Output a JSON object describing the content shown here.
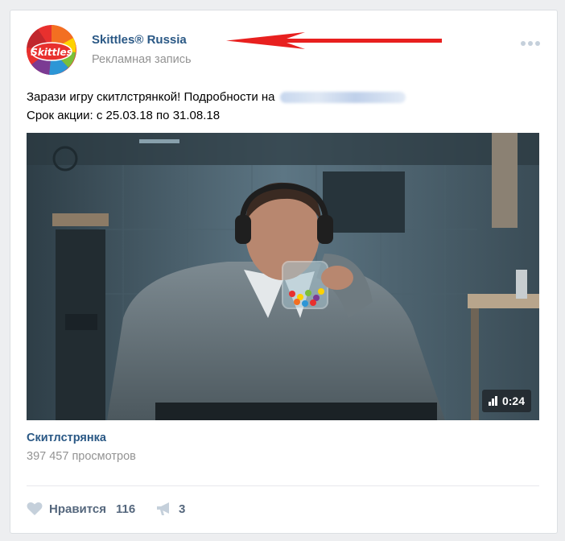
{
  "post": {
    "author": "Skittles® Russia",
    "post_type": "Рекламная запись",
    "text_line1": "Зарази игру скитлстрянкой! Подробности на",
    "text_line2": "Срок акции: с 25.03.18 по 31.08.18",
    "avatar_logo_text": "Skittles"
  },
  "video": {
    "duration": "0:24",
    "title": "Скитлстрянка",
    "views": "397 457 просмотров"
  },
  "actions": {
    "like_label": "Нравится",
    "like_count": "116",
    "share_count": "3"
  },
  "icons": {
    "more": "more-dots-icon",
    "like": "heart-icon",
    "share": "megaphone-icon",
    "duration": "bars-icon",
    "annotation": "red-arrow-icon"
  },
  "colors": {
    "link": "#2a5885",
    "muted": "#939393",
    "action": "#55677d",
    "annotation": "#e8201f"
  }
}
